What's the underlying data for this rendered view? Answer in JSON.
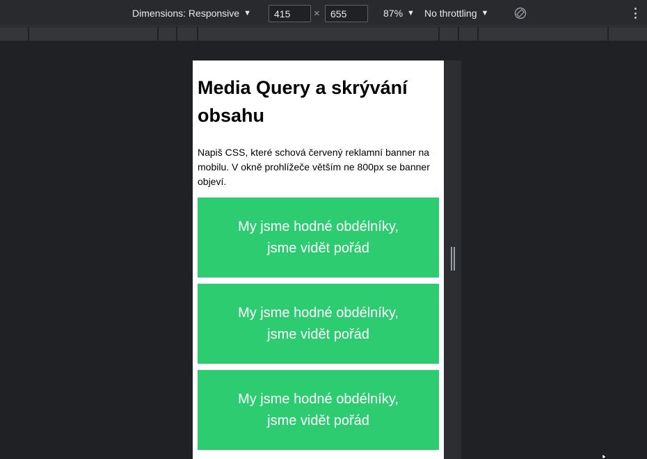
{
  "toolbar": {
    "dimensions_label": "Dimensions: Responsive",
    "width_value": "415",
    "height_value": "655",
    "times_symbol": "×",
    "zoom_label": "87%",
    "throttling_label": "No throttling",
    "caret": "▼",
    "rotate_icon": "rotate-icon",
    "more_icon": "more-vertical-icon"
  },
  "page": {
    "heading": "Media Query a skrývání obsahu",
    "description": "Napiš CSS, které schová červený reklamní banner na mobilu. V okně prohlížeče větším ne 800px se banner objeví.",
    "boxes": [
      {
        "text": "My jsme hodné obdélníky, jsme vidět pořád"
      },
      {
        "text": "My jsme hodné obdélníky, jsme vidět pořád"
      },
      {
        "text": "My jsme hodné obdélníky, jsme vidět pořád"
      }
    ],
    "box_color": "#2ecc71"
  },
  "colors": {
    "devtools_bg": "#202124",
    "toolbar_bg": "#292a2d",
    "ruler_bg": "#35363a"
  }
}
